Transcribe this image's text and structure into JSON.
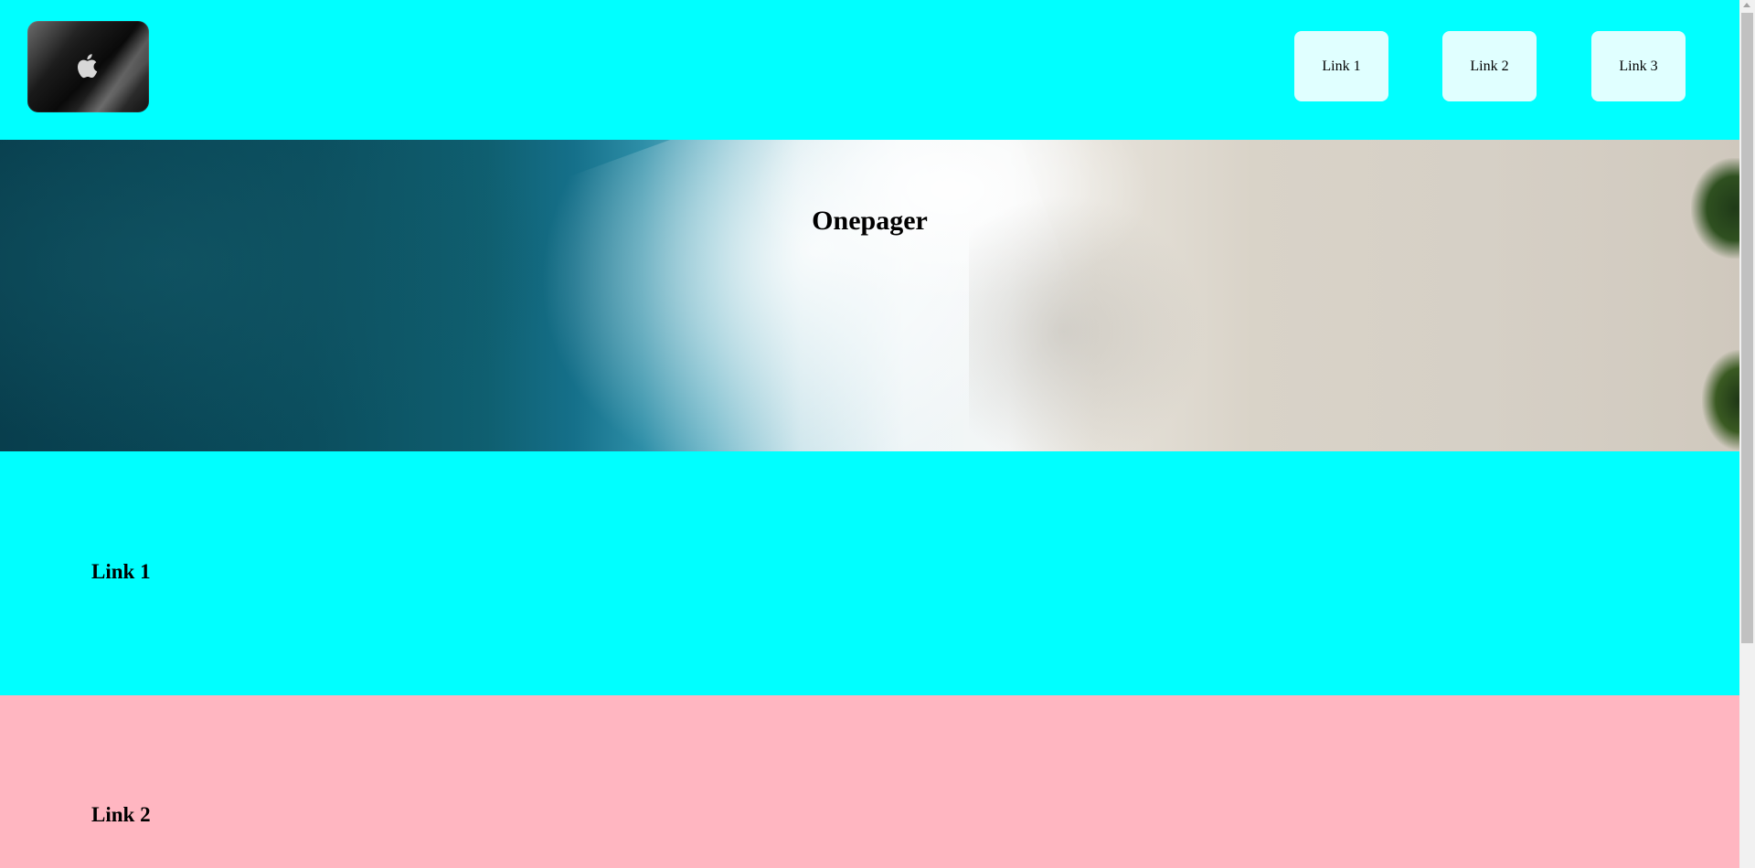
{
  "header": {
    "logo_icon": "apple-logo-icon",
    "nav": [
      {
        "label": "Link 1"
      },
      {
        "label": "Link 2"
      },
      {
        "label": "Link 3"
      }
    ],
    "background": "#00ffff",
    "button_background": "#e0ffff"
  },
  "hero": {
    "title": "Onepager",
    "image": "aerial ocean wave and beach"
  },
  "sections": [
    {
      "heading": "Link 1",
      "background": "#00ffff"
    },
    {
      "heading": "Link 2",
      "background": "#ffb6c1"
    }
  ]
}
